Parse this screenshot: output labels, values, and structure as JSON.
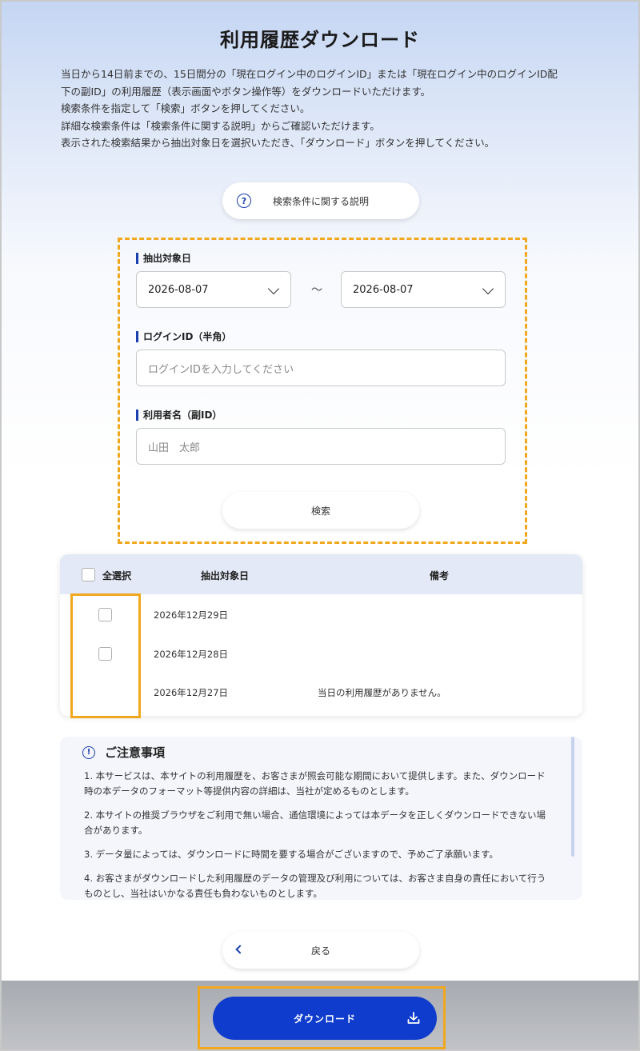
{
  "page": {
    "title": "利用履歴ダウンロード",
    "intro": [
      "当日から14日前までの、15日間分の「現在ログイン中のログインID」または「現在ログイン中のログインID配",
      "下の副ID」の利用履歴（表示画面やボタン操作等）をダウンロードいただけます。",
      "検索条件を指定して「検索」ボタンを押してください。",
      "詳細な検索条件は「検索条件に関する説明」からご確認いただけます。",
      "表示された検索結果から抽出対象日を選択いただき、「ダウンロード」ボタンを押してください。"
    ]
  },
  "help_button": {
    "label": "検索条件に関する説明",
    "icon": "question-circle-icon",
    "icon_glyph": "?"
  },
  "form": {
    "date_label": "抽出対象日",
    "date_from": "2026-08-07",
    "date_to": "2026-08-07",
    "tilde": "～",
    "login_label": "ログインID（半角）",
    "login_placeholder": "ログインIDを入力してください",
    "user_label": "利用者名（副ID）",
    "user_placeholder": "山田　太郎",
    "search_label": "検索"
  },
  "table": {
    "select_all": "全選択",
    "col_date": "抽出対象日",
    "col_note": "備考",
    "rows": [
      {
        "date": "2026年12月29日",
        "note": ""
      },
      {
        "date": "2026年12月28日",
        "note": ""
      },
      {
        "date": "2026年12月27日",
        "note": "当日の利用履歴がありません。"
      }
    ]
  },
  "notice": {
    "title": "ご注意事項",
    "icon_glyph": "!",
    "items": [
      "1. 本サービスは、本サイトの利用履歴を、お客さまが照会可能な期間において提供します。また、ダウンロード時の本データのフォーマット等提供内容の詳細は、当社が定めるものとします。",
      "2. 本サイトの推奨ブラウザをご利用で無い場合、通信環境によっては本データを正しくダウンロードできない場合があります。",
      "3. データ量によっては、ダウンロードに時間を要する場合がございますので、予めご了承願います。",
      "4. お客さまがダウンロードした利用履歴のデータの管理及び利用については、お客さま自身の責任において行うものとし、当社はいかなる責任も負わないものとします。"
    ]
  },
  "back_button": {
    "label": "戻る"
  },
  "download_button": {
    "label": "ダウンロード",
    "icon": "download-icon"
  },
  "colors": {
    "accent": "#1a3fae",
    "download": "#0f3ccc",
    "highlight": "#f1a81e"
  }
}
